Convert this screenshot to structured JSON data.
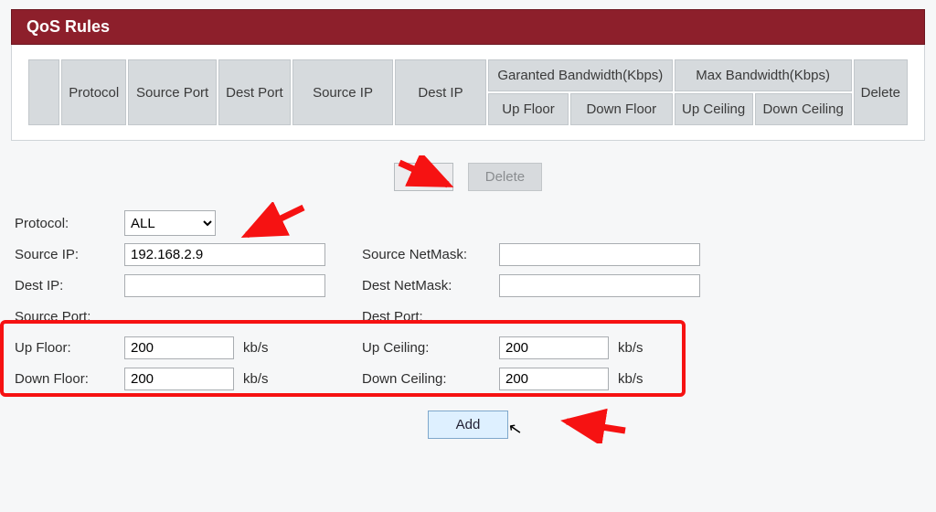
{
  "title": "QoS Rules",
  "table": {
    "headers": {
      "protocol": "Protocol",
      "source_port": "Source Port",
      "dest_port": "Dest Port",
      "source_ip": "Source IP",
      "dest_ip": "Dest IP",
      "garanted": "Garanted Bandwidth(Kbps)",
      "max": "Max Bandwidth(Kbps)",
      "delete": "Delete",
      "up_floor": "Up Floor",
      "down_floor": "Down Floor",
      "up_ceiling": "Up Ceiling",
      "down_ceiling": "Down Ceiling"
    }
  },
  "buttons": {
    "add_top": "Add",
    "delete_top": "Delete",
    "add_bottom": "Add"
  },
  "labels": {
    "protocol": "Protocol:",
    "source_ip": "Source IP:",
    "dest_ip": "Dest IP:",
    "source_port": "Source Port:",
    "source_netmask": "Source NetMask:",
    "dest_netmask": "Dest NetMask:",
    "dest_port": "Dest Port:",
    "up_floor": "Up Floor:",
    "up_ceiling": "Up Ceiling:",
    "down_floor": "Down Floor:",
    "down_ceiling": "Down Ceiling:",
    "unit": "kb/s"
  },
  "form": {
    "protocol": "ALL",
    "source_ip": "192.168.2.9",
    "dest_ip": "",
    "source_port": "",
    "source_netmask": "",
    "dest_netmask": "",
    "dest_port": "",
    "up_floor": "200",
    "up_ceiling": "200",
    "down_floor": "200",
    "down_ceiling": "200"
  }
}
